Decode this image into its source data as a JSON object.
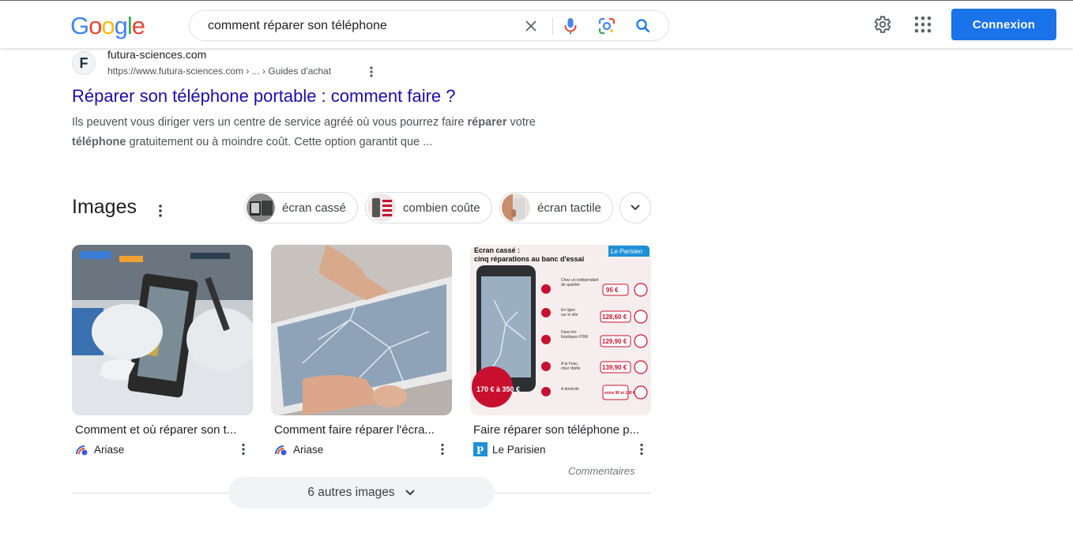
{
  "header": {
    "logo": [
      "G",
      "o",
      "o",
      "g",
      "l",
      "e"
    ],
    "logo_colors": [
      "#4285f4",
      "#ea4335",
      "#fbbc05",
      "#4285f4",
      "#34a853",
      "#ea4335"
    ],
    "search_value": "comment réparer son téléphone",
    "signin_label": "Connexion",
    "accent": "#1a73e8"
  },
  "result": {
    "site_name": "futura-sciences.com",
    "site_url": "https://www.futura-sciences.com › ... › Guides d'achat",
    "favicon_letter": "F",
    "title": "Réparer son téléphone portable : comment faire ?",
    "snippet_1": "Ils peuvent vous diriger vers un centre de service agréé où vous pourrez faire ",
    "snippet_b1": "réparer",
    "snippet_2": " votre ",
    "snippet_b2": "téléphone",
    "snippet_3": " gratuitement ou à moindre coût. Cette option garantit que ..."
  },
  "images": {
    "heading": "Images",
    "chips": [
      {
        "label": "écran cassé"
      },
      {
        "label": "combien coûte"
      },
      {
        "label": "écran tactile"
      }
    ],
    "cards": [
      {
        "caption": "Comment et où réparer son t...",
        "source": "Ariase"
      },
      {
        "caption": "Comment faire réparer l'écra...",
        "source": "Ariase"
      },
      {
        "caption": "Faire réparer son téléphone p...",
        "source": "Le Parisien"
      }
    ],
    "infographic": {
      "title_1": "Ecran cassé :",
      "title_2": "cinq réparations au banc d'essai",
      "brand": "Le Parisien",
      "prices": [
        "95 €",
        "128,60 €",
        "129,90 €",
        "139,90 €",
        "entre 90 et 100 €"
      ],
      "badge": "170 € à 350 €"
    },
    "comments_label": "Commentaires",
    "more_label": "6 autres images"
  }
}
